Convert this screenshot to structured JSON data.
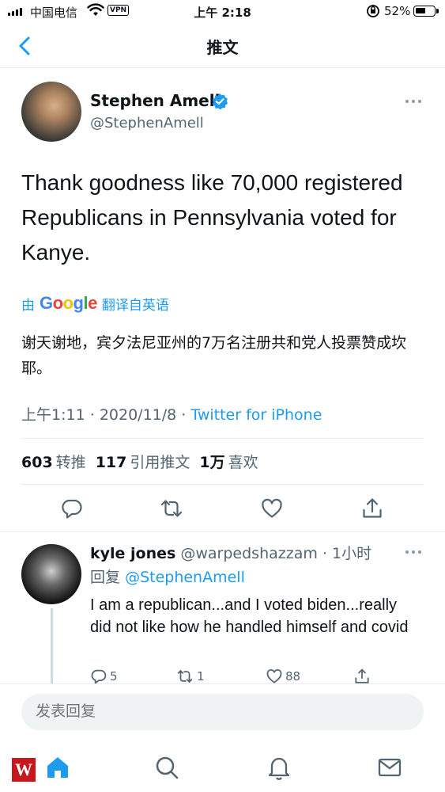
{
  "status_bar": {
    "carrier": "中国电信",
    "vpn": "VPN",
    "time": "上午 2:18",
    "battery": "52%"
  },
  "header": {
    "title": "推文"
  },
  "tweet": {
    "author_name": "Stephen Amell",
    "author_handle": "@StephenAmell",
    "text": "Thank goodness like 70,000 registered Republicans in Pennsylvania voted for Kanye.",
    "translate_prefix": "由",
    "translate_brand": "Google",
    "translate_suffix": "翻译自英语",
    "translated_text": "谢天谢地，宾夕法尼亚州的7万名注册共和党人投票赞成坎耶。",
    "time": "上午1:11",
    "date": "2020/11/8",
    "source": "Twitter for iPhone",
    "separator": "·"
  },
  "stats": {
    "retweets_count": "603",
    "retweets_label": "转推",
    "quotes_count": "117",
    "quotes_label": "引用推文",
    "likes_count": "1万",
    "likes_label": "喜欢"
  },
  "reply": {
    "name": "kyle jones",
    "handle": "@warpedshazzam",
    "separator": "·",
    "age": "1小时",
    "replying_prefix": "回复",
    "replying_to": "@StephenAmell",
    "text": "I am a republican...and I voted biden...really did not like how he handled himself and covid",
    "reply_count": "5",
    "retweet_count": "1",
    "like_count": "88"
  },
  "composer": {
    "placeholder": "发表回复"
  },
  "colors": {
    "accent": "#1d9bf0",
    "text": "#0f1419",
    "secondary": "#536471",
    "divider": "#e6ecf0"
  },
  "icons": [
    "back-chevron-icon",
    "verified-badge-icon",
    "more-icon",
    "reply-icon",
    "retweet-icon",
    "like-icon",
    "share-icon",
    "home-icon",
    "search-icon",
    "notifications-icon",
    "messages-icon"
  ]
}
